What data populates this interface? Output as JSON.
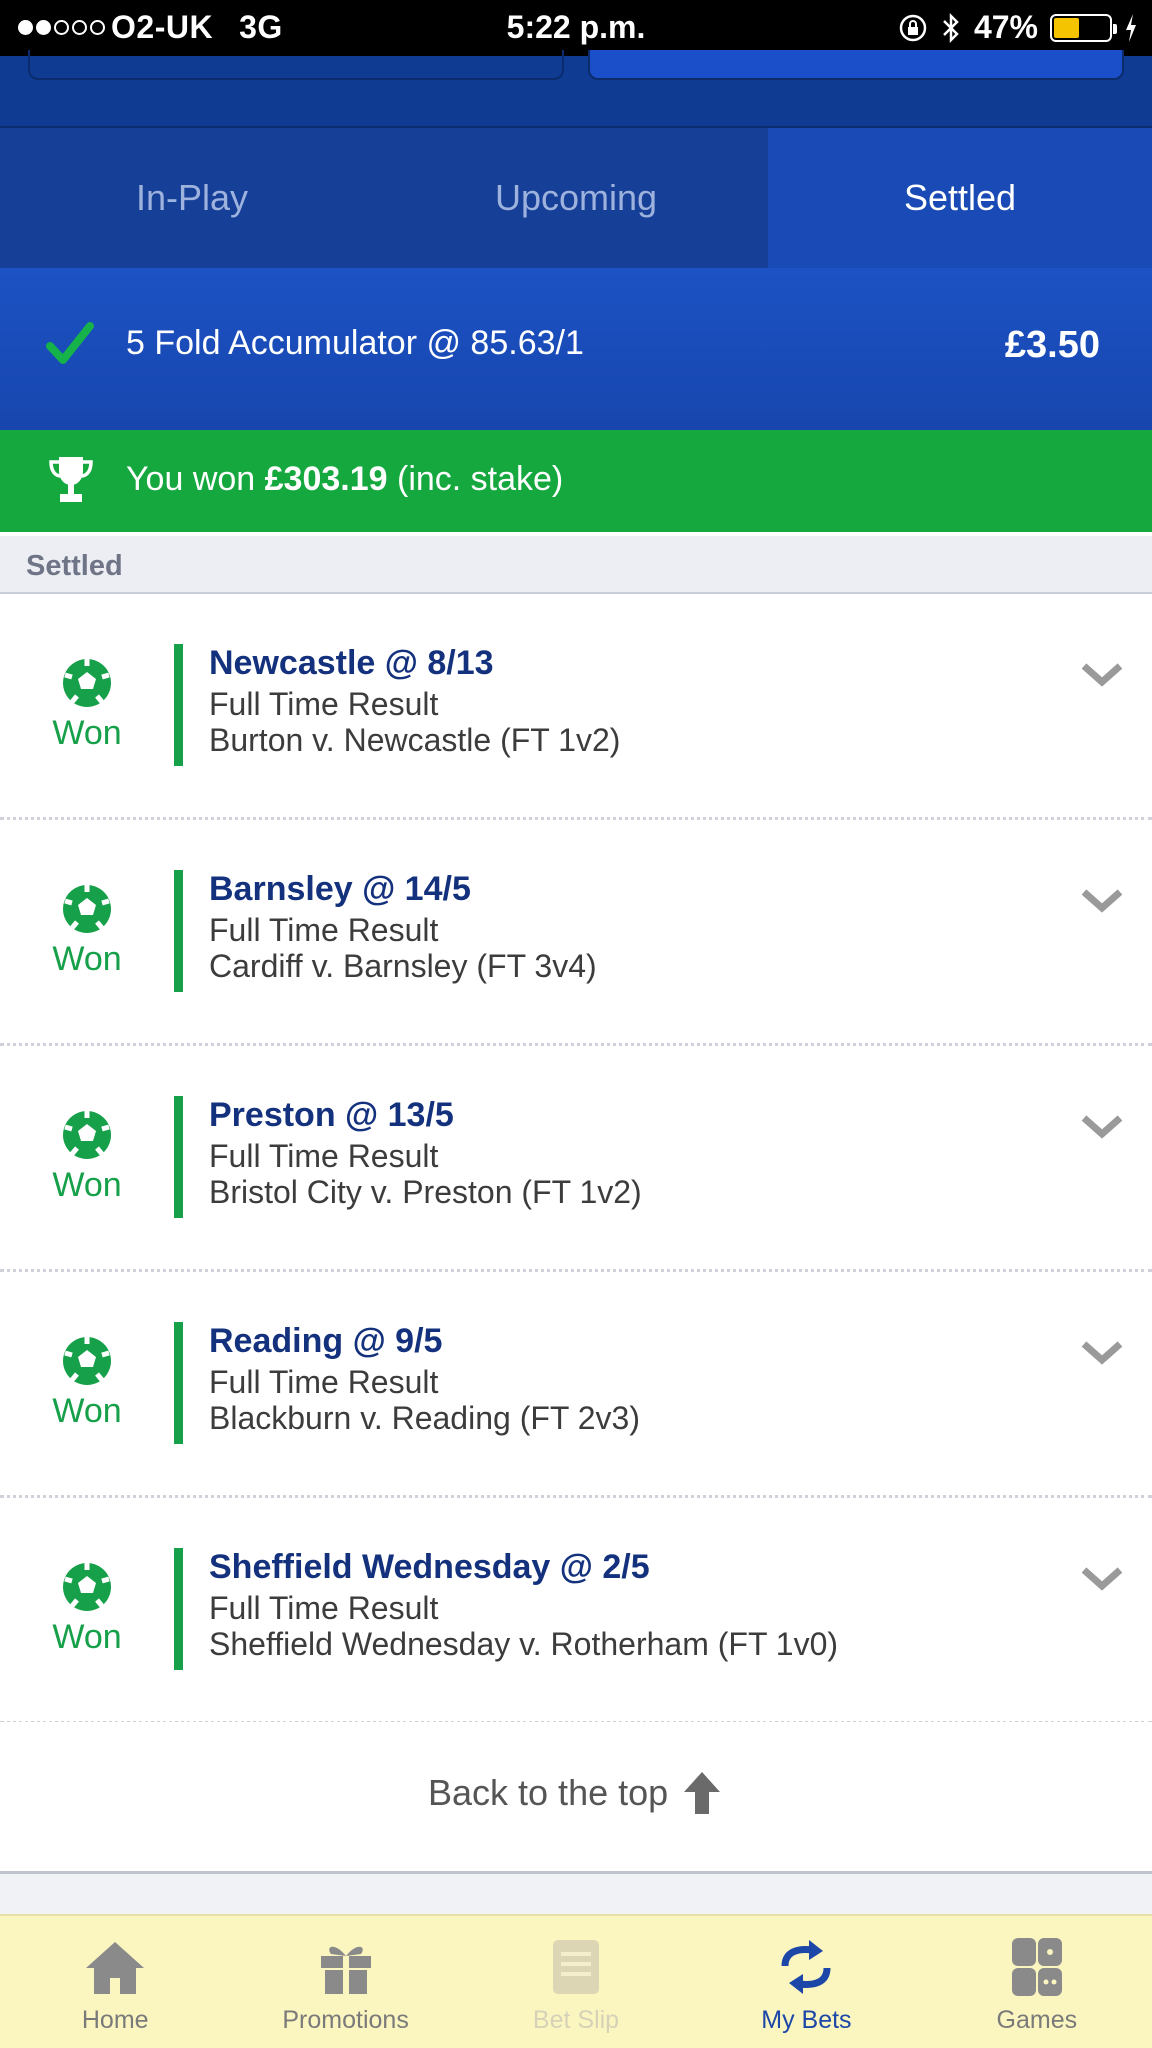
{
  "status_bar": {
    "carrier": "O2-UK",
    "network": "3G",
    "time": "5:22 p.m.",
    "battery": "47%",
    "battery_level": 0.47,
    "signal_bars": 2
  },
  "tabs": [
    {
      "label": "In-Play",
      "active": false
    },
    {
      "label": "Upcoming",
      "active": false
    },
    {
      "label": "Settled",
      "active": true
    }
  ],
  "bet": {
    "title": "5 Fold Accumulator @ 85.63/1",
    "stake": "£3.50",
    "won_prefix": "You won ",
    "won_amount": "£303.19",
    "won_suffix": " (inc. stake)"
  },
  "section": {
    "label": "Settled"
  },
  "selections": [
    {
      "result": "Won",
      "name": "Newcastle @ 8/13",
      "market": "Full Time Result",
      "event": "Burton v. Newcastle (FT 1v2)"
    },
    {
      "result": "Won",
      "name": "Barnsley @ 14/5",
      "market": "Full Time Result",
      "event": "Cardiff v. Barnsley (FT 3v4)"
    },
    {
      "result": "Won",
      "name": "Preston @ 13/5",
      "market": "Full Time Result",
      "event": "Bristol City v. Preston (FT 1v2)"
    },
    {
      "result": "Won",
      "name": "Reading @ 9/5",
      "market": "Full Time Result",
      "event": "Blackburn v. Reading (FT 2v3)"
    },
    {
      "result": "Won",
      "name": "Sheffield Wednesday @ 2/5",
      "market": "Full Time Result",
      "event": "Sheffield Wednesday v. Rotherham (FT 1v0)"
    }
  ],
  "back_to_top": {
    "label": "Back to the top"
  },
  "bottom_nav": [
    {
      "label": "Home",
      "icon": "home-icon",
      "active": false
    },
    {
      "label": "Promotions",
      "icon": "gift-icon",
      "active": false
    },
    {
      "label": "Bet Slip",
      "icon": "betslip-icon",
      "active": false,
      "disabled": true
    },
    {
      "label": "My Bets",
      "icon": "mybets-icon",
      "active": true
    },
    {
      "label": "Games",
      "icon": "games-icon",
      "active": false
    }
  ],
  "colors": {
    "brand_blue": "#1746ae",
    "won_green": "#14a83e",
    "nav_active": "#1c46a8",
    "nav_bg": "#fbf6c0"
  }
}
